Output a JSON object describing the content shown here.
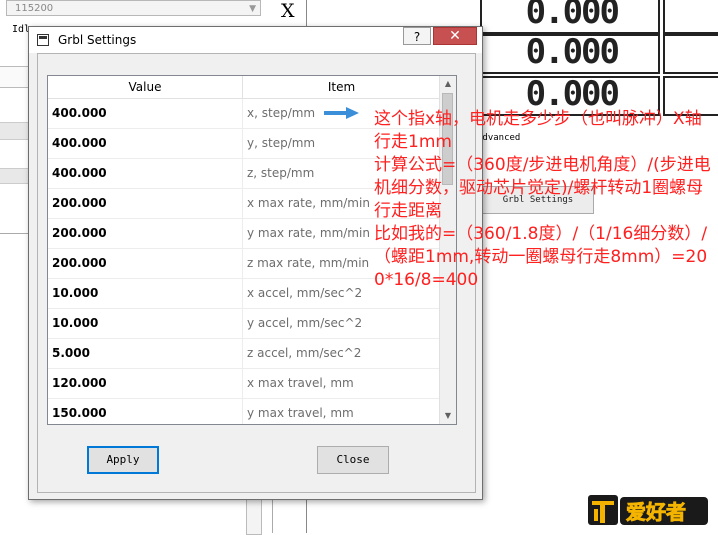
{
  "background": {
    "port_combo_value": "115200",
    "axis_label": "X",
    "status_text": "Idle",
    "readouts": [
      "0.000",
      "0.000",
      "0.000"
    ],
    "advanced_label": "Advanced",
    "settings_button_label": "Grbl Settings"
  },
  "dialog": {
    "title": "Grbl Settings",
    "help_label": "?",
    "close_label": "✕",
    "columns": [
      "Value",
      "Item"
    ],
    "rows": [
      {
        "value": "400.000",
        "item": "x, step/mm"
      },
      {
        "value": "400.000",
        "item": "y, step/mm"
      },
      {
        "value": "400.000",
        "item": "z, step/mm"
      },
      {
        "value": "200.000",
        "item": "x max rate, mm/min"
      },
      {
        "value": "200.000",
        "item": "y max rate, mm/min"
      },
      {
        "value": "200.000",
        "item": "z max rate, mm/min"
      },
      {
        "value": "10.000",
        "item": "x accel, mm/sec^2"
      },
      {
        "value": "10.000",
        "item": "y accel, mm/sec^2"
      },
      {
        "value": "5.000",
        "item": "z accel, mm/sec^2"
      },
      {
        "value": "120.000",
        "item": "x max travel, mm"
      },
      {
        "value": "150.000",
        "item": "y max travel, mm"
      }
    ],
    "apply_label": "Apply",
    "close_button_label": "Close"
  },
  "annotation": {
    "text": "这个指x轴，电机走多少步（也叫脉冲）X轴行走1mm\n计算公式=（360度/步进电机角度）/(步进电机细分数，驱动芯片觉定)/螺杆转动1圈螺母行走距离\n比如我的=（360/1.8度）/（1/16细分数）/（螺距1mm,转动一圈螺母行走8mm）=200*16/8=400",
    "color": "#ff2020",
    "arrow_color": "#3b8ed8"
  },
  "watermark": {
    "text": "爱好者"
  }
}
